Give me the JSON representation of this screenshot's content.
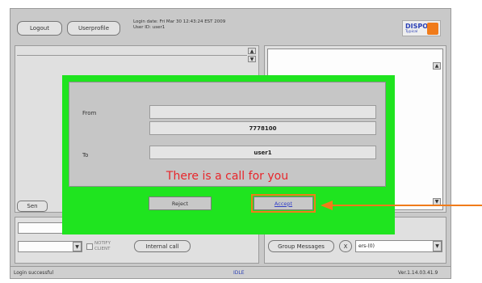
{
  "header": {
    "logout_label": "Logout",
    "userprofile_label": "Userprofile",
    "login_info_line1": "Login date: Fri Mar 30 12:43:24 EST 2009",
    "login_info_line2": "User ID: user1",
    "logo_text": "DISPO",
    "logo_sub": "Typical"
  },
  "left_panel": {
    "send_label": "Sen"
  },
  "dial": {
    "notify_line1": "NOTIFY",
    "notify_line2": "CLIENT",
    "intercall_label": "Internal call"
  },
  "right_bottom": {
    "group_messages_label": "Group Messages",
    "x_label": "X",
    "select_value": "ers-(0)"
  },
  "statusbar": {
    "message": "Login successful",
    "mode": "IDLE",
    "version": "Ver.1.14.03.41.9"
  },
  "dialog": {
    "from_label": "From",
    "from_value": "",
    "from_number": "7778100",
    "to_label": "To",
    "to_value": "user1",
    "message": "There is a call for you",
    "reject_label": "Reject",
    "accept_label": "Accept"
  },
  "colors": {
    "dialog_bg": "#1fe41f",
    "call_text": "#e8262b",
    "annotation": "#f07b1a"
  }
}
